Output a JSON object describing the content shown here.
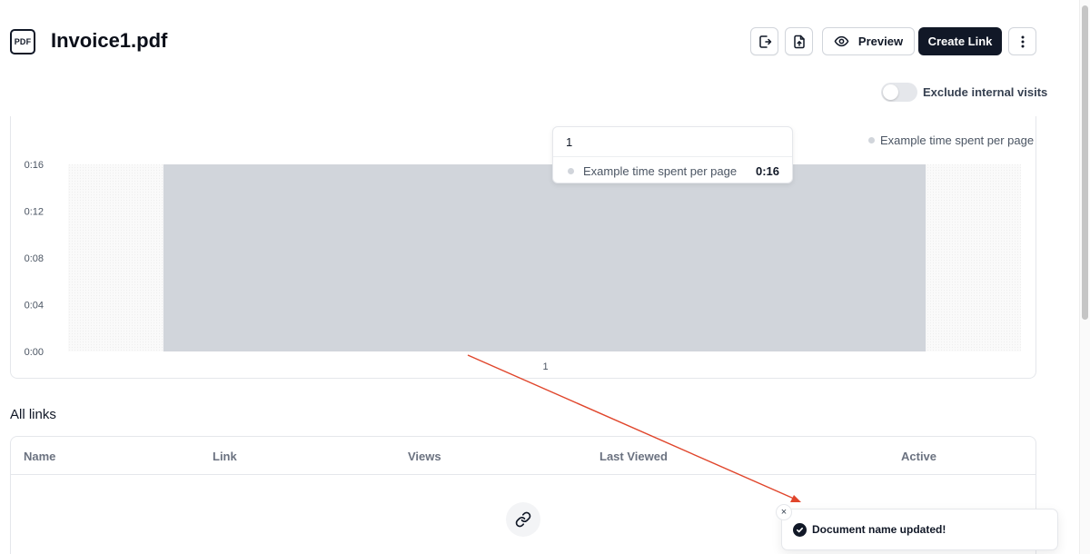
{
  "header": {
    "file_badge": "PDF",
    "title": "Invoice1.pdf",
    "preview_label": "Preview",
    "create_link_label": "Create Link"
  },
  "filters": {
    "exclude_internal_label": "Exclude internal visits",
    "exclude_internal_on": false
  },
  "chart_data": {
    "type": "bar",
    "categories": [
      "1"
    ],
    "series": [
      {
        "name": "Example time spent per page",
        "values": [
          16
        ],
        "color": "#d1d5db"
      }
    ],
    "yticks": [
      "0:00",
      "0:04",
      "0:08",
      "0:12",
      "0:16"
    ],
    "ytick_values": [
      0,
      4,
      8,
      12,
      16
    ],
    "ylim": [
      0,
      16
    ],
    "legend": "top-right",
    "tooltip": {
      "title": "1",
      "series": "Example time spent per page",
      "value": "0:16"
    }
  },
  "links": {
    "section_title": "All links",
    "columns": [
      "Name",
      "Link",
      "Views",
      "Last Viewed",
      "Active"
    ]
  },
  "toast": {
    "message": "Document name updated!",
    "close_glyph": "×"
  },
  "icons": {
    "file_badge": "file-pdf-icon",
    "export": "export-icon",
    "upload": "upload-file-icon",
    "preview": "eye-icon",
    "more": "more-vertical-icon",
    "empty_links": "link-icon",
    "toast_success": "check-circle-icon",
    "toast_close": "close-icon"
  },
  "colors": {
    "primary": "#111827",
    "bar": "#d1d5db",
    "annotation_arrow": "#e0452b"
  }
}
